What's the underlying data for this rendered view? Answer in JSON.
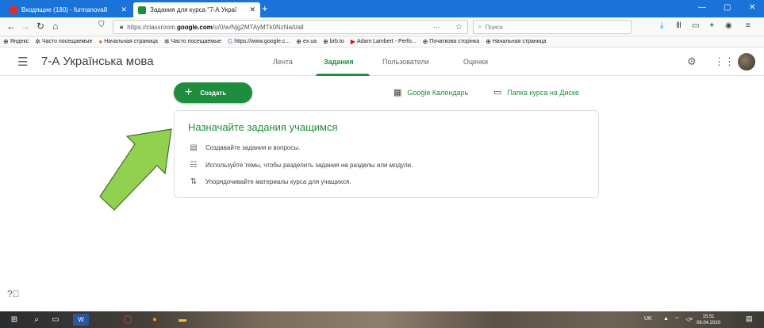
{
  "browser": {
    "tabs": [
      {
        "label": "Входящие (180) - furmanova8",
        "active": false,
        "favicon_color": "#d93025"
      },
      {
        "label": "Задания для курса \"7-А Украї",
        "active": true,
        "favicon_color": "#1e8e3e"
      }
    ],
    "new_tab": "+",
    "window_controls": {
      "minimize": "—",
      "maximize": "▢",
      "close": "✕"
    },
    "url": {
      "prefix": "https://classroom.",
      "host": "google.com",
      "path": "/u/0/w/Njg2MTAyMTk0NzNa/t/all",
      "more": "···"
    },
    "search_placeholder": "Поиск",
    "bookmarks": [
      "Яндекс",
      "Часто посещаемые",
      "Начальная страница",
      "Часто посещаемые",
      "https://www.google.c...",
      "ex.ua",
      "brb.to",
      "Adam Lambert - Perfo...",
      "Початкова сторінка",
      "Начальная страница"
    ]
  },
  "classroom": {
    "course_title": "7-А Українська мова",
    "nav_tabs": [
      "Лента",
      "Задания",
      "Пользователи",
      "Оценки"
    ],
    "active_tab_index": 1,
    "create_button": {
      "icon": "+",
      "label": "Создать"
    },
    "links": {
      "calendar": "Google Календарь",
      "drive": "Папка курса на Диске"
    },
    "card": {
      "title": "Назначайте задания учащимся",
      "items": [
        {
          "icon": "assignment-icon",
          "text": "Создавайте задания и вопросы."
        },
        {
          "icon": "topic-list-icon",
          "text": "Используйте темы, чтобы разделить задания на разделы или модули."
        },
        {
          "icon": "reorder-icon",
          "text": "Упорядочивайте материалы курса для учащихся."
        }
      ]
    },
    "accent_color": "#1e8e3e",
    "annotation_arrow_color": "#92d050"
  },
  "taskbar": {
    "language": "UK",
    "time": "15:51",
    "date": "08.04.2020"
  }
}
